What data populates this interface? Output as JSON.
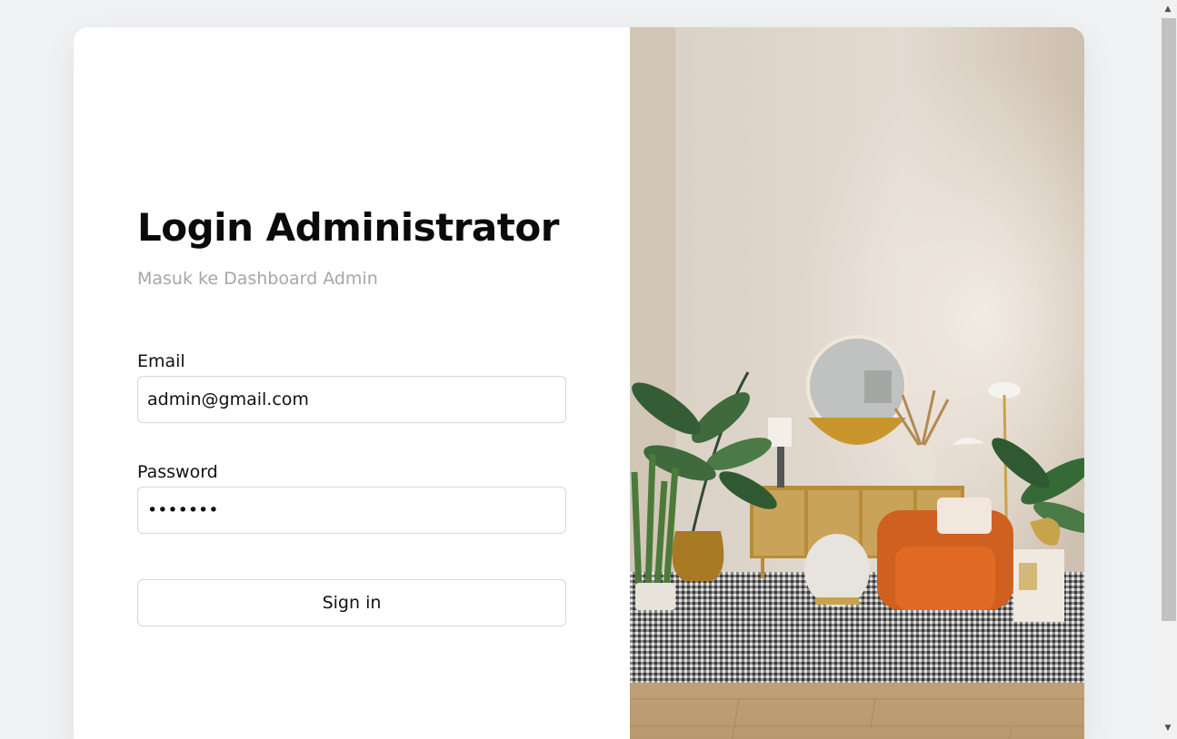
{
  "login": {
    "title": "Login Administrator",
    "subtitle": "Masuk ke Dashboard Admin",
    "email_label": "Email",
    "email_value": "admin@gmail.com",
    "password_label": "Password",
    "password_value": "•••••••",
    "submit_label": "Sign in"
  },
  "hero_image": {
    "subject": "living room interior with plants, orange armchair, round mirror and rug"
  },
  "colors": {
    "page_background": "#f1f2f4",
    "card_background": "#ffffff",
    "subtitle_text": "#a6a6ab",
    "field_border": "#d6d7db"
  },
  "scrollbar": {
    "up_arrow": "▲",
    "down_arrow": "▼"
  }
}
